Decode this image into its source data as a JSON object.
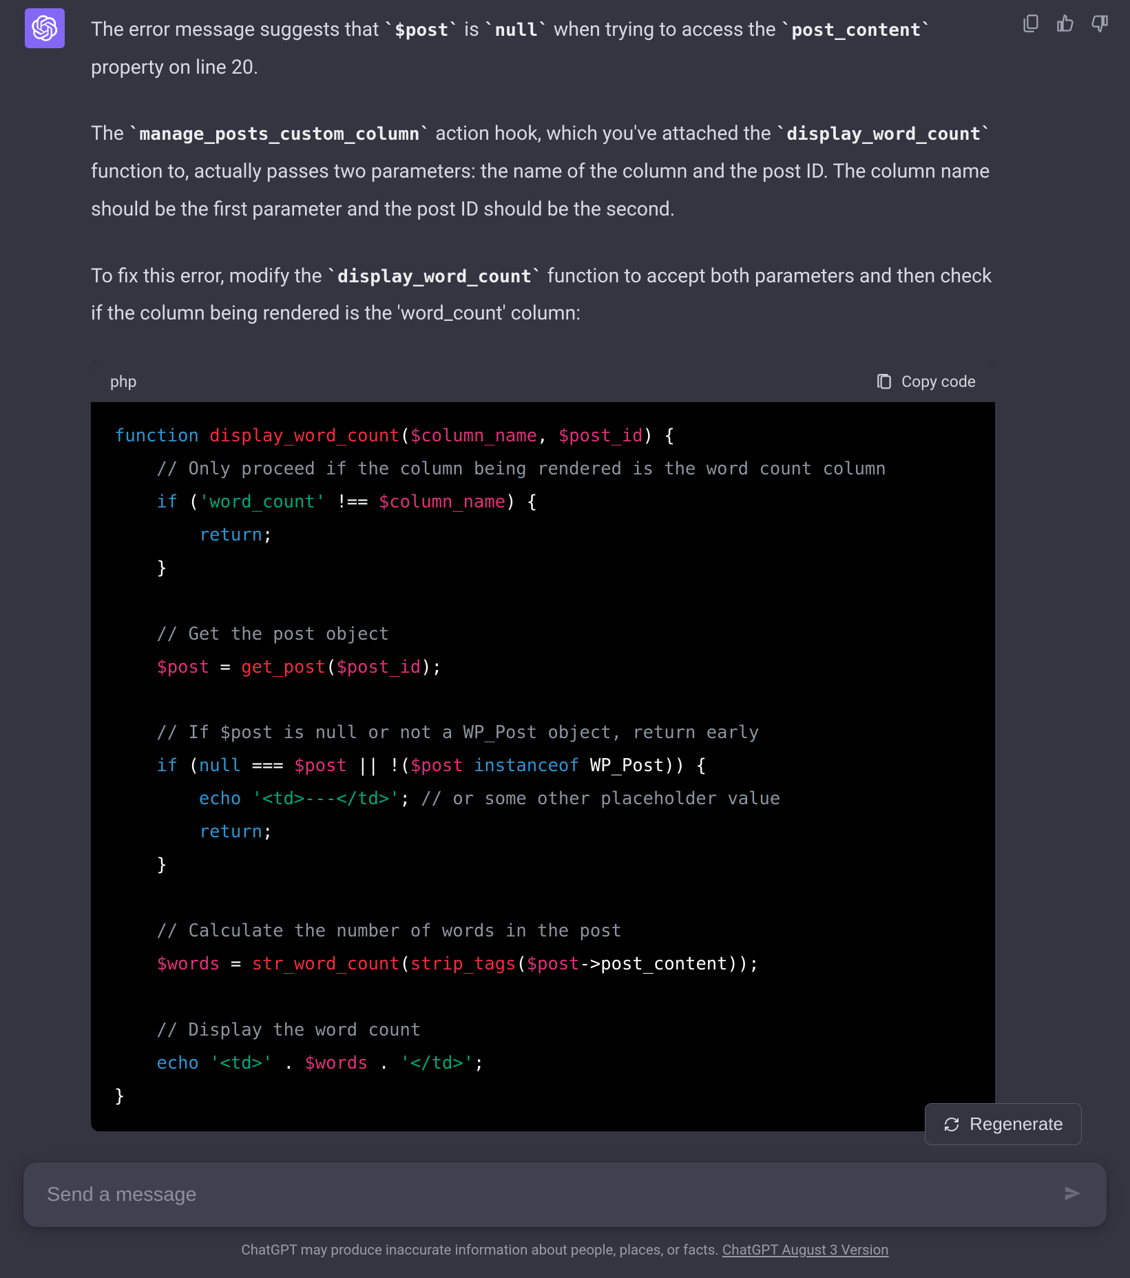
{
  "message": {
    "para1_seg1": "The error message suggests that ",
    "para1_code1": "`$post`",
    "para1_seg2": " is ",
    "para1_code2": "`null`",
    "para1_seg3": " when trying to access the ",
    "para1_code3": "`post_content`",
    "para1_seg4": " property on line 20.",
    "para2_seg1": "The ",
    "para2_code1": "`manage_posts_custom_column`",
    "para2_seg2": " action hook, which you've attached the ",
    "para2_code2": "`display_word_count`",
    "para2_seg3": " function to, actually passes two parameters: the name of the column and the post ID. The column name should be the first parameter and the post ID should be the second.",
    "para3_seg1": "To fix this error, modify the ",
    "para3_code1": "`display_word_count`",
    "para3_seg2": " function to accept both parameters and then check if the column being rendered is the 'word_count' column:"
  },
  "codeblock": {
    "language": "php",
    "copy_label": "Copy code",
    "tokens": {
      "l1_kw": "function",
      "l1_fn": "display_word_count",
      "l1_op1": "(",
      "l1_v1": "$column_name",
      "l1_c": ", ",
      "l1_v2": "$post_id",
      "l1_op2": ") {",
      "l2_cm": "// Only proceed if the column being rendered is the word count column",
      "l3_kw": "if",
      "l3_op1": " (",
      "l3_str": "'word_count'",
      "l3_op2": " !== ",
      "l3_v": "$column_name",
      "l3_op3": ") {",
      "l4_kw": "return",
      "l4_op": ";",
      "l5_op": "}",
      "l7_cm": "// Get the post object",
      "l8_v1": "$post",
      "l8_op1": " = ",
      "l8_fn": "get_post",
      "l8_op2": "(",
      "l8_v2": "$post_id",
      "l8_op3": ");",
      "l10_cm": "// If $post is null or not a WP_Post object, return early",
      "l11_kw1": "if",
      "l11_op1": " (",
      "l11_kw2": "null",
      "l11_op2": " === ",
      "l11_v1": "$post",
      "l11_op3": " || !(",
      "l11_v2": "$post",
      "l11_sp": " ",
      "l11_kw3": "instanceof",
      "l11_op4": " WP_Post)) {",
      "l12_kw": "echo",
      "l12_sp": " ",
      "l12_str": "'<td>---</td>'",
      "l12_op": "; ",
      "l12_cm": "// or some other placeholder value",
      "l13_kw": "return",
      "l13_op": ";",
      "l14_op": "}",
      "l16_cm": "// Calculate the number of words in the post",
      "l17_v1": "$words",
      "l17_op1": " = ",
      "l17_fn1": "str_word_count",
      "l17_op2": "(",
      "l17_fn2": "strip_tags",
      "l17_op3": "(",
      "l17_v2": "$post",
      "l17_op4": "->post_content));",
      "l19_cm": "// Display the word count",
      "l20_kw": "echo",
      "l20_sp": " ",
      "l20_str1": "'<td>'",
      "l20_op1": " . ",
      "l20_v": "$words",
      "l20_op2": " . ",
      "l20_str2": "'</td>'",
      "l20_op3": ";",
      "l21_op": "}"
    }
  },
  "regen_label": "Regenerate",
  "input_placeholder": "Send a message",
  "disclaimer_text": "ChatGPT may produce inaccurate information about people, places, or facts. ",
  "disclaimer_link": "ChatGPT August 3 Version"
}
